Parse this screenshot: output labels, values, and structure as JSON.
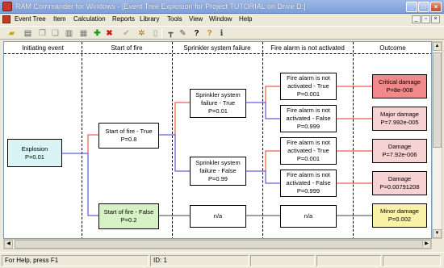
{
  "window": {
    "title": "RAM Commander for Windows - [Event Tree Explosion for Project TUTORIAL on Drive D:]"
  },
  "menu": [
    "Event Tree",
    "Item",
    "Calculation",
    "Reports",
    "Library",
    "Tools",
    "View",
    "Window",
    "Help"
  ],
  "toolbar": {
    "icons": [
      "open-folder-icon",
      "print-icon",
      "copy-icon",
      "paste-icon",
      "save-icon",
      "grid-icon",
      "add-icon",
      "delete-icon",
      "check-icon",
      "calculate-icon",
      "document-icon",
      "tree-icon",
      "edit-icon",
      "context-help-icon",
      "help-icon",
      "info-icon"
    ]
  },
  "columns": [
    "Initiating event",
    "Start of fire",
    "Sprinkler system failure",
    "Fire alarm is not activated",
    "Outcome"
  ],
  "nodes": {
    "explosion": {
      "line1": "Explosion",
      "line2": "P=0.01"
    },
    "fire_true": {
      "line1": "Start of fire - True",
      "line2": "P=0.8"
    },
    "fire_false": {
      "line1": "Start of fire - False",
      "line2": "P=0.2"
    },
    "sprinkler_true": {
      "line1": "Sprinkler system",
      "line2": "failure - True",
      "line3": "P=0.01"
    },
    "sprinkler_false": {
      "line1": "Sprinkler system",
      "line2": "failure - False",
      "line3": "P=0.99"
    },
    "sprinkler_na": {
      "line1": "n/a"
    },
    "alarm_1": {
      "line1": "Fire alarm is not",
      "line2": "activated - True",
      "line3": "P=0.001"
    },
    "alarm_2": {
      "line1": "Fire alarm is not",
      "line2": "activated - False",
      "line3": "P=0.999"
    },
    "alarm_3": {
      "line1": "Fire alarm is not",
      "line2": "activated - True",
      "line3": "P=0.001"
    },
    "alarm_4": {
      "line1": "Fire alarm is not",
      "line2": "activated - False",
      "line3": "P=0.999"
    },
    "alarm_na": {
      "line1": "n/a"
    },
    "out_1": {
      "line1": "Critical damage",
      "line2": "P=8e-008",
      "color": "#f08a8a"
    },
    "out_2": {
      "line1": "Major damage",
      "line2": "P=7.992e-005",
      "color": "#f7d2d2"
    },
    "out_3": {
      "line1": "Damage",
      "line2": "P=7.92e-006",
      "color": "#f7d2d2"
    },
    "out_4": {
      "line1": "Damage",
      "line2": "P=0.00791208",
      "color": "#f7d2d2"
    },
    "out_5": {
      "line1": "Minor damage",
      "line2": "P=0.002",
      "color": "#f9f2a8"
    }
  },
  "status": {
    "help": "For Help, press F1",
    "id": "ID: 1"
  },
  "colors": {
    "explosion_fill": "#d8f4f4",
    "fire_false_fill": "#d6f2c4",
    "true_branch": "#e03a2a",
    "false_branch": "#3a3ad0",
    "na_branch": "#444444"
  }
}
